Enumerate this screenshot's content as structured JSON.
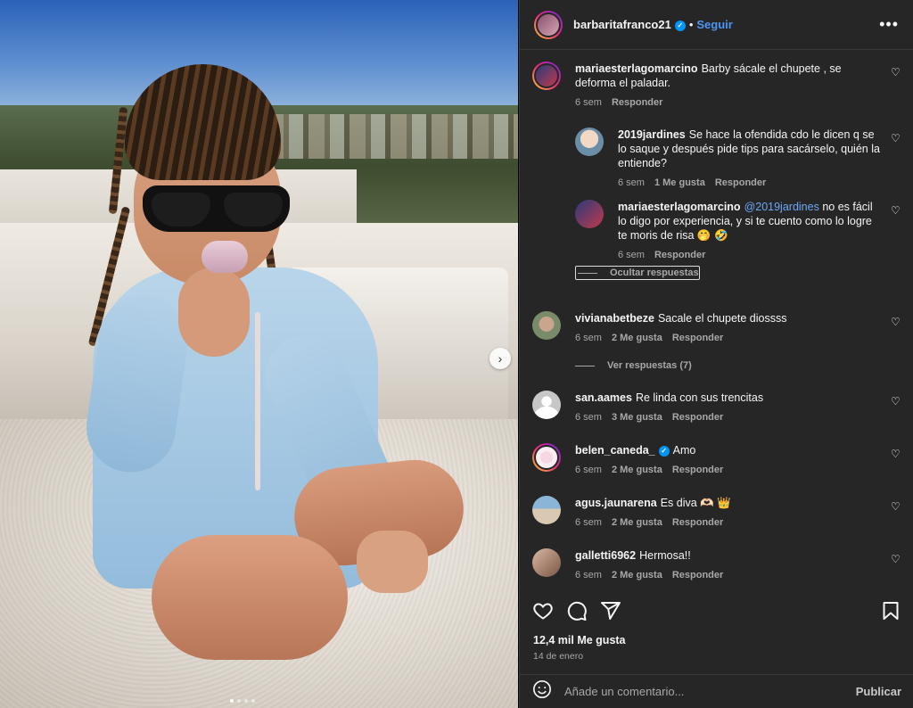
{
  "post": {
    "username": "barbaritafranco21",
    "follow_label": "Seguir",
    "separator": "•",
    "more_label": "•••",
    "next_arrow": "›",
    "carousel": {
      "count": 4,
      "active": 0
    }
  },
  "comments": [
    {
      "username": "mariaesterlagomarcino",
      "text": "Barby sácale el chupete , se deforma el paladar.",
      "time": "6 sem",
      "likes": "",
      "reply_label": "Responder"
    },
    {
      "username": "2019jardines",
      "text": "Se hace la ofendida cdo le dicen q se lo saque y después pide tips para sacárselo, quién la entiende?",
      "time": "6 sem",
      "likes": "1 Me gusta",
      "reply_label": "Responder"
    },
    {
      "username": "mariaesterlagomarcino",
      "mention": "@2019jardines",
      "text": "no es fácil lo digo por experiencia, y si te cuento como lo logre te moris de risa 🤭 🤣",
      "time": "6 sem",
      "likes": "",
      "reply_label": "Responder"
    },
    {
      "username": "vivianabetbeze",
      "text": "Sacale el chupete diossss",
      "time": "6 sem",
      "likes": "2 Me gusta",
      "reply_label": "Responder"
    },
    {
      "username": "san.aames",
      "text": "Re linda con sus trencitas",
      "time": "6 sem",
      "likes": "3 Me gusta",
      "reply_label": "Responder"
    },
    {
      "username": "belen_caneda_",
      "text": "Amo",
      "time": "6 sem",
      "likes": "2 Me gusta",
      "reply_label": "Responder"
    },
    {
      "username": "agus.jaunarena",
      "text": "Es diva 🫶🏻 👑",
      "time": "6 sem",
      "likes": "2 Me gusta",
      "reply_label": "Responder"
    },
    {
      "username": "galletti6962",
      "text": "Hermosa!!",
      "time": "6 sem",
      "likes": "2 Me gusta",
      "reply_label": "Responder"
    }
  ],
  "threads": {
    "hide_replies": "Ocultar respuestas",
    "view_replies": "Ver respuestas (7)"
  },
  "footer": {
    "likes": "12,4 mil Me gusta",
    "date": "14 de enero",
    "comment_placeholder": "Añade un comentario...",
    "publish_label": "Publicar"
  },
  "icons": {
    "heart": "heart-icon",
    "comment": "comment-icon",
    "share": "share-icon",
    "save": "bookmark-icon",
    "emoji": "emoji-icon",
    "verified": "verified-badge-icon"
  },
  "colors": {
    "panel_bg": "#262626",
    "link": "#4c95f6",
    "mention": "#6ea7f7",
    "verified": "#0095f6",
    "muted": "#a8a8a8"
  }
}
